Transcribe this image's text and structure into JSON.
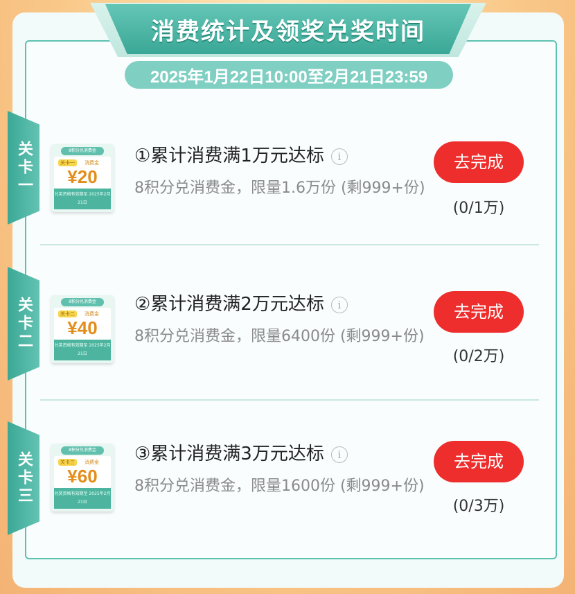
{
  "header": {
    "title": "消费统计及领奖兑奖时间",
    "period": "2025年1月22日10:00至2月21日23:59"
  },
  "levels": [
    {
      "tab_label": "关卡一",
      "title": "①累计消费满1万元达标",
      "desc": "8积分兑消费金，限量1.6万份 (剩999+份)",
      "button": "去完成",
      "progress": "(0/1万)",
      "coupon": {
        "header": "8积分兑消费金",
        "tag": "关卡一",
        "tag_label": "消费金",
        "amount": "¥20",
        "footer": "兑奖资格有效期至 2025年2月21日"
      }
    },
    {
      "tab_label": "关卡二",
      "title": "②累计消费满2万元达标",
      "desc": "8积分兑消费金，限量6400份 (剩999+份)",
      "button": "去完成",
      "progress": "(0/2万)",
      "coupon": {
        "header": "8积分兑消费金",
        "tag": "关卡二",
        "tag_label": "消费金",
        "amount": "¥40",
        "footer": "兑奖资格有效期至 2025年2月21日"
      }
    },
    {
      "tab_label": "关卡三",
      "title": "③累计消费满3万元达标",
      "desc": "8积分兑消费金，限量1600份 (剩999+份)",
      "button": "去完成",
      "progress": "(0/3万)",
      "coupon": {
        "header": "8积分兑消费金",
        "tag": "关卡三",
        "tag_label": "消费金",
        "amount": "¥60",
        "footer": "兑奖资格有效期至 2025年2月21日"
      }
    }
  ],
  "icons": {
    "info": "info-icon"
  },
  "colors": {
    "accent": "#4db59f",
    "button": "#ee2d2d"
  }
}
